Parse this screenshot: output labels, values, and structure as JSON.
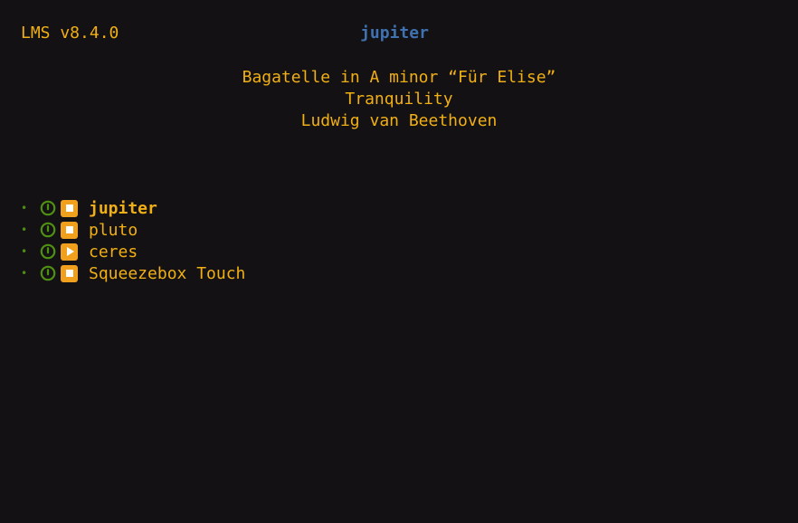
{
  "header": {
    "server_version": "LMS v8.4.0",
    "active_player": "jupiter"
  },
  "now_playing": {
    "title": "Bagatelle in A minor “Für Elise”",
    "album": "Tranquility",
    "artist": "Ludwig van Beethoven"
  },
  "players": [
    {
      "name": "jupiter",
      "power": "on",
      "state": "stopped",
      "state_icon": "stop-icon",
      "active": true
    },
    {
      "name": "pluto",
      "power": "on",
      "state": "stopped",
      "state_icon": "stop-icon",
      "active": false
    },
    {
      "name": "ceres",
      "power": "on",
      "state": "playing",
      "state_icon": "play-icon",
      "active": false
    },
    {
      "name": "Squeezebox Touch",
      "power": "on",
      "state": "stopped",
      "state_icon": "stop-icon",
      "active": false
    }
  ],
  "colors": {
    "background": "#141114",
    "text": "#f0b015",
    "active_player_header": "#3f72b0",
    "power_on": "#4f8f12",
    "state_badge": "#f0a01c"
  }
}
